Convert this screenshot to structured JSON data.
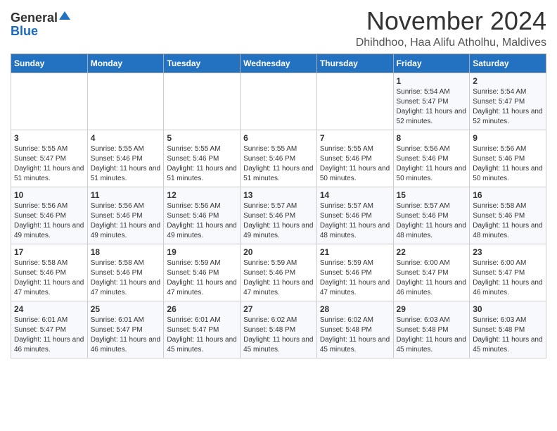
{
  "logo": {
    "general": "General",
    "blue": "Blue"
  },
  "header": {
    "month": "November 2024",
    "location": "Dhihdhoo, Haa Alifu Atholhu, Maldives"
  },
  "days_of_week": [
    "Sunday",
    "Monday",
    "Tuesday",
    "Wednesday",
    "Thursday",
    "Friday",
    "Saturday"
  ],
  "weeks": [
    [
      {
        "day": "",
        "info": ""
      },
      {
        "day": "",
        "info": ""
      },
      {
        "day": "",
        "info": ""
      },
      {
        "day": "",
        "info": ""
      },
      {
        "day": "",
        "info": ""
      },
      {
        "day": "1",
        "info": "Sunrise: 5:54 AM\nSunset: 5:47 PM\nDaylight: 11 hours and 52 minutes."
      },
      {
        "day": "2",
        "info": "Sunrise: 5:54 AM\nSunset: 5:47 PM\nDaylight: 11 hours and 52 minutes."
      }
    ],
    [
      {
        "day": "3",
        "info": "Sunrise: 5:55 AM\nSunset: 5:47 PM\nDaylight: 11 hours and 51 minutes."
      },
      {
        "day": "4",
        "info": "Sunrise: 5:55 AM\nSunset: 5:46 PM\nDaylight: 11 hours and 51 minutes."
      },
      {
        "day": "5",
        "info": "Sunrise: 5:55 AM\nSunset: 5:46 PM\nDaylight: 11 hours and 51 minutes."
      },
      {
        "day": "6",
        "info": "Sunrise: 5:55 AM\nSunset: 5:46 PM\nDaylight: 11 hours and 51 minutes."
      },
      {
        "day": "7",
        "info": "Sunrise: 5:55 AM\nSunset: 5:46 PM\nDaylight: 11 hours and 50 minutes."
      },
      {
        "day": "8",
        "info": "Sunrise: 5:56 AM\nSunset: 5:46 PM\nDaylight: 11 hours and 50 minutes."
      },
      {
        "day": "9",
        "info": "Sunrise: 5:56 AM\nSunset: 5:46 PM\nDaylight: 11 hours and 50 minutes."
      }
    ],
    [
      {
        "day": "10",
        "info": "Sunrise: 5:56 AM\nSunset: 5:46 PM\nDaylight: 11 hours and 49 minutes."
      },
      {
        "day": "11",
        "info": "Sunrise: 5:56 AM\nSunset: 5:46 PM\nDaylight: 11 hours and 49 minutes."
      },
      {
        "day": "12",
        "info": "Sunrise: 5:56 AM\nSunset: 5:46 PM\nDaylight: 11 hours and 49 minutes."
      },
      {
        "day": "13",
        "info": "Sunrise: 5:57 AM\nSunset: 5:46 PM\nDaylight: 11 hours and 49 minutes."
      },
      {
        "day": "14",
        "info": "Sunrise: 5:57 AM\nSunset: 5:46 PM\nDaylight: 11 hours and 48 minutes."
      },
      {
        "day": "15",
        "info": "Sunrise: 5:57 AM\nSunset: 5:46 PM\nDaylight: 11 hours and 48 minutes."
      },
      {
        "day": "16",
        "info": "Sunrise: 5:58 AM\nSunset: 5:46 PM\nDaylight: 11 hours and 48 minutes."
      }
    ],
    [
      {
        "day": "17",
        "info": "Sunrise: 5:58 AM\nSunset: 5:46 PM\nDaylight: 11 hours and 47 minutes."
      },
      {
        "day": "18",
        "info": "Sunrise: 5:58 AM\nSunset: 5:46 PM\nDaylight: 11 hours and 47 minutes."
      },
      {
        "day": "19",
        "info": "Sunrise: 5:59 AM\nSunset: 5:46 PM\nDaylight: 11 hours and 47 minutes."
      },
      {
        "day": "20",
        "info": "Sunrise: 5:59 AM\nSunset: 5:46 PM\nDaylight: 11 hours and 47 minutes."
      },
      {
        "day": "21",
        "info": "Sunrise: 5:59 AM\nSunset: 5:46 PM\nDaylight: 11 hours and 47 minutes."
      },
      {
        "day": "22",
        "info": "Sunrise: 6:00 AM\nSunset: 5:47 PM\nDaylight: 11 hours and 46 minutes."
      },
      {
        "day": "23",
        "info": "Sunrise: 6:00 AM\nSunset: 5:47 PM\nDaylight: 11 hours and 46 minutes."
      }
    ],
    [
      {
        "day": "24",
        "info": "Sunrise: 6:01 AM\nSunset: 5:47 PM\nDaylight: 11 hours and 46 minutes."
      },
      {
        "day": "25",
        "info": "Sunrise: 6:01 AM\nSunset: 5:47 PM\nDaylight: 11 hours and 46 minutes."
      },
      {
        "day": "26",
        "info": "Sunrise: 6:01 AM\nSunset: 5:47 PM\nDaylight: 11 hours and 45 minutes."
      },
      {
        "day": "27",
        "info": "Sunrise: 6:02 AM\nSunset: 5:48 PM\nDaylight: 11 hours and 45 minutes."
      },
      {
        "day": "28",
        "info": "Sunrise: 6:02 AM\nSunset: 5:48 PM\nDaylight: 11 hours and 45 minutes."
      },
      {
        "day": "29",
        "info": "Sunrise: 6:03 AM\nSunset: 5:48 PM\nDaylight: 11 hours and 45 minutes."
      },
      {
        "day": "30",
        "info": "Sunrise: 6:03 AM\nSunset: 5:48 PM\nDaylight: 11 hours and 45 minutes."
      }
    ]
  ]
}
